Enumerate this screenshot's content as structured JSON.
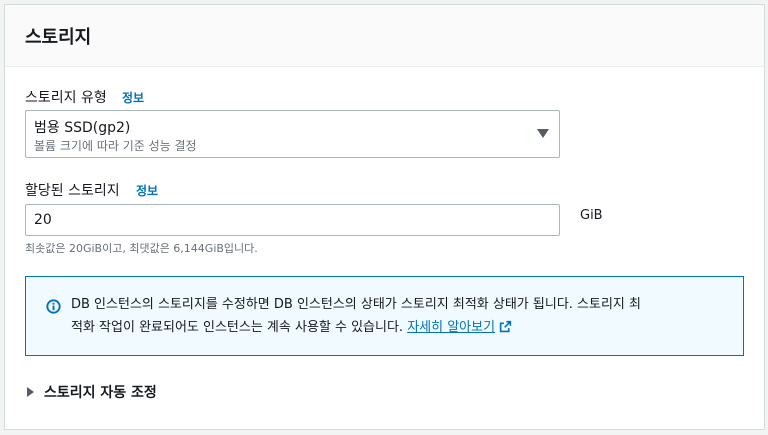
{
  "panel": {
    "title": "스토리지"
  },
  "storage_type": {
    "label": "스토리지 유형",
    "info_link": "정보",
    "selected_value": "범용 SSD(gp2)",
    "selected_description": "볼륨 크기에 따라 기준 성능 결정"
  },
  "allocated_storage": {
    "label": "할당된 스토리지",
    "info_link": "정보",
    "value": "20",
    "unit": "GiB",
    "constraint": "최솟값은 20GiB이고, 최댓값은 6,144GiB입니다."
  },
  "alert": {
    "line1": "DB 인스턴스의 스토리지를 수정하면 DB 인스턴스의 상태가 스토리지 최적화 상태가 됩니다. 스토리지 최",
    "line2": "적화 작업이 완료되어도 인스턴스는 계속 사용할 수 있습니다. ",
    "link_text": "자세히 알아보기",
    "icon": "info-circle-icon"
  },
  "autoscaling": {
    "label": "스토리지 자동 조정"
  },
  "colors": {
    "link": "#0073bb",
    "alert_background": "#f1faff",
    "alert_border": "#0073bb"
  }
}
